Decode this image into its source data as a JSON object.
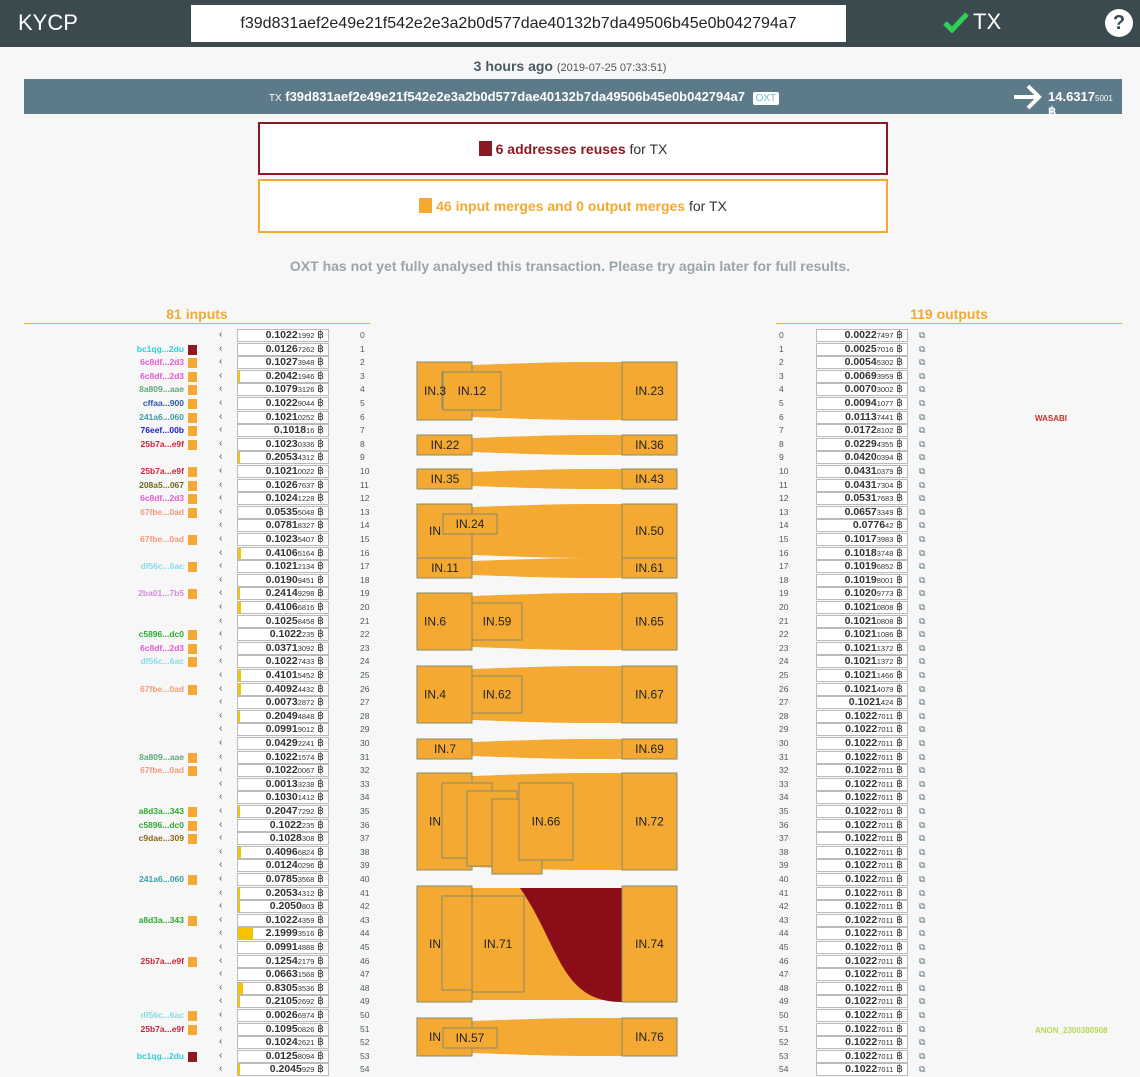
{
  "app": {
    "brand": "KYCP",
    "search_value": "f39d831aef2e49e21f542e2e3a2b0d577dae40132b7da49506b45e0b042794a7",
    "tx_label": "TX",
    "help": "?"
  },
  "time": {
    "relative": "3 hours ago",
    "absolute": "(2019-07-25 07:33:51)"
  },
  "txbar": {
    "prefix": "TX",
    "txid": "f39d831aef2e49e21f542e2e3a2b0d577dae40132b7da49506b45e0b042794a7",
    "oxt": "OXT",
    "amount_main": "14.6317",
    "amount_small": "5001",
    "btc": "฿"
  },
  "boxes": {
    "reuse_count": "6 addresses reuses",
    "reuse_suffix": " for TX",
    "merge_count": "46 input merges and 0 output merges",
    "merge_suffix": " for TX"
  },
  "note": "OXT has not yet fully analysed this transaction. Please try again later for full results.",
  "inputs_header": "81 inputs",
  "outputs_header": "119 outputs",
  "colors": {
    "reuse": "#8b1a25",
    "merge": "#f3a932",
    "bar": "#5d7a88",
    "yellow": "#f6c300"
  },
  "inputs": [
    {
      "label": "",
      "color": "",
      "v1": "0.1022",
      "v2": "1992",
      "fill": 0
    },
    {
      "label": "bc1qg...2du",
      "color": "#2dcfd8",
      "sq": "#8b1a25",
      "v1": "0.0126",
      "v2": "7262",
      "fill": 0
    },
    {
      "label": "6c8df...2d3",
      "color": "#e45ad6",
      "sq": "#f3a932",
      "v1": "0.1027",
      "v2": "3948",
      "fill": 0
    },
    {
      "label": "6c8df...2d3",
      "color": "#e45ad6",
      "sq": "#f3a932",
      "v1": "0.2042",
      "v2": "1946",
      "fill": 2
    },
    {
      "label": "8a809...aae",
      "color": "#5fa87a",
      "sq": "#f3a932",
      "v1": "0.1079",
      "v2": "3126",
      "fill": 0
    },
    {
      "label": "cffaa...900",
      "color": "#2b5aa8",
      "sq": "#f3a932",
      "v1": "0.1022",
      "v2": "9044",
      "fill": 0
    },
    {
      "label": "241a6...060",
      "color": "#3a9ea8",
      "sq": "#f3a932",
      "v1": "0.1021",
      "v2": "0252",
      "fill": 0
    },
    {
      "label": "76eef...00b",
      "color": "#1c22c8",
      "sq": "#f3a932",
      "v1": "0.1018",
      "v2": "16",
      "fill": 0
    },
    {
      "label": "25b7a...e9f",
      "color": "#c8243a",
      "sq": "#f3a932",
      "v1": "0.1023",
      "v2": "0336",
      "fill": 0
    },
    {
      "label": "",
      "color": "",
      "v1": "0.2053",
      "v2": "4312",
      "fill": 2
    },
    {
      "label": "25b7a...e9f",
      "color": "#c8243a",
      "sq": "#f3a932",
      "v1": "0.1021",
      "v2": "0022",
      "fill": 0
    },
    {
      "label": "208a5...067",
      "color": "#6c6c18",
      "sq": "#f3a932",
      "v1": "0.1026",
      "v2": "7637",
      "fill": 0
    },
    {
      "label": "6c8df...2d3",
      "color": "#e45ad6",
      "sq": "#f3a932",
      "v1": "0.1024",
      "v2": "1228",
      "fill": 0
    },
    {
      "label": "67fbe...0ad",
      "color": "#f29a7a",
      "sq": "#f3a932",
      "v1": "0.0535",
      "v2": "5048",
      "fill": 0
    },
    {
      "label": "",
      "color": "",
      "v1": "0.0781",
      "v2": "8327",
      "fill": 0
    },
    {
      "label": "67fbe...0ad",
      "color": "#f29a7a",
      "sq": "#f3a932",
      "v1": "0.1023",
      "v2": "5407",
      "fill": 0
    },
    {
      "label": "",
      "color": "",
      "v1": "0.4106",
      "v2": "5164",
      "fill": 3
    },
    {
      "label": "df56c...6ac",
      "color": "#8adbe8",
      "sq": "#f3a932",
      "v1": "0.1021",
      "v2": "2134",
      "fill": 0
    },
    {
      "label": "",
      "color": "",
      "v1": "0.0190",
      "v2": "9451",
      "fill": 0
    },
    {
      "label": "2ba01...7b5",
      "color": "#d58ae0",
      "sq": "#f3a932",
      "v1": "0.2414",
      "v2": "9298",
      "fill": 2
    },
    {
      "label": "",
      "color": "",
      "v1": "0.4106",
      "v2": "6816",
      "fill": 3
    },
    {
      "label": "",
      "color": "",
      "v1": "0.1025",
      "v2": "8458",
      "fill": 0
    },
    {
      "label": "c5896...dc0",
      "color": "#2fa833",
      "sq": "#f3a932",
      "v1": "0.1022",
      "v2": "235",
      "fill": 0
    },
    {
      "label": "6c8df...2d3",
      "color": "#e45ad6",
      "sq": "#f3a932",
      "v1": "0.0371",
      "v2": "3092",
      "fill": 0
    },
    {
      "label": "df56c...6ac",
      "color": "#8adbe8",
      "sq": "#f3a932",
      "v1": "0.1022",
      "v2": "7433",
      "fill": 0
    },
    {
      "label": "",
      "color": "",
      "v1": "0.4101",
      "v2": "5452",
      "fill": 3
    },
    {
      "label": "67fbe...0ad",
      "color": "#f29a7a",
      "sq": "#f3a932",
      "v1": "0.4092",
      "v2": "4432",
      "fill": 3
    },
    {
      "label": "",
      "color": "",
      "v1": "0.0073",
      "v2": "2872",
      "fill": 0
    },
    {
      "label": "",
      "color": "",
      "v1": "0.2049",
      "v2": "4848",
      "fill": 2
    },
    {
      "label": "",
      "color": "",
      "v1": "0.0991",
      "v2": "9012",
      "fill": 0
    },
    {
      "label": "",
      "color": "",
      "v1": "0.0429",
      "v2": "2241",
      "fill": 0
    },
    {
      "label": "8a809...aae",
      "color": "#5fa87a",
      "sq": "#f3a932",
      "v1": "0.1022",
      "v2": "1574",
      "fill": 0
    },
    {
      "label": "67fbe...0ad",
      "color": "#f29a7a",
      "sq": "#f3a932",
      "v1": "0.1022",
      "v2": "0067",
      "fill": 0
    },
    {
      "label": "",
      "color": "",
      "v1": "0.0013",
      "v2": "3238",
      "fill": 0
    },
    {
      "label": "",
      "color": "",
      "v1": "0.1030",
      "v2": "1412",
      "fill": 0
    },
    {
      "label": "a8d3a...343",
      "color": "#2fa833",
      "sq": "#f3a932",
      "v1": "0.2047",
      "v2": "7292",
      "fill": 2
    },
    {
      "label": "c5896...dc0",
      "color": "#2fa833",
      "sq": "#f3a932",
      "v1": "0.1022",
      "v2": "235",
      "fill": 0
    },
    {
      "label": "c9dae...309",
      "color": "#8a6a18",
      "sq": "#f3a932",
      "v1": "0.1028",
      "v2": "308",
      "fill": 0
    },
    {
      "label": "",
      "color": "",
      "v1": "0.4096",
      "v2": "6824",
      "fill": 3
    },
    {
      "label": "",
      "color": "",
      "v1": "0.0124",
      "v2": "0296",
      "fill": 0
    },
    {
      "label": "241a6...060",
      "color": "#3a9ea8",
      "sq": "#f3a932",
      "v1": "0.0785",
      "v2": "3568",
      "fill": 0
    },
    {
      "label": "",
      "color": "",
      "v1": "0.2053",
      "v2": "4312",
      "fill": 2
    },
    {
      "label": "",
      "color": "",
      "v1": "0.2050",
      "v2": "803",
      "fill": 2
    },
    {
      "label": "a8d3a...343",
      "color": "#2fa833",
      "sq": "#f3a932",
      "v1": "0.1022",
      "v2": "4359",
      "fill": 0
    },
    {
      "label": "",
      "color": "",
      "v1": "2.1999",
      "v2": "3516",
      "fill": 15
    },
    {
      "label": "",
      "color": "",
      "v1": "0.0991",
      "v2": "4888",
      "fill": 0
    },
    {
      "label": "25b7a...e9f",
      "color": "#c8243a",
      "sq": "#f3a932",
      "v1": "0.1254",
      "v2": "2179",
      "fill": 0
    },
    {
      "label": "",
      "color": "",
      "v1": "0.0663",
      "v2": "1568",
      "fill": 0
    },
    {
      "label": "",
      "color": "",
      "v1": "0.8305",
      "v2": "3536",
      "fill": 5
    },
    {
      "label": "",
      "color": "",
      "v1": "0.2105",
      "v2": "2692",
      "fill": 2
    },
    {
      "label": "df56c...6ac",
      "color": "#8adbe8",
      "sq": "#f3a932",
      "v1": "0.0026",
      "v2": "6974",
      "fill": 0
    },
    {
      "label": "25b7a...e9f",
      "color": "#c8243a",
      "sq": "#f3a932",
      "v1": "0.1095",
      "v2": "0826",
      "fill": 0
    },
    {
      "label": "",
      "color": "",
      "v1": "0.1024",
      "v2": "2621",
      "fill": 0
    },
    {
      "label": "bc1qg...2du",
      "color": "#2dcfd8",
      "sq": "#8b1a25",
      "v1": "0.0125",
      "v2": "8094",
      "fill": 0
    },
    {
      "label": "",
      "color": "",
      "v1": "0.2045",
      "v2": "929",
      "fill": 2
    }
  ],
  "outputs": [
    {
      "v1": "0.0022",
      "v2": "7497"
    },
    {
      "v1": "0.0025",
      "v2": "7016"
    },
    {
      "v1": "0.0054",
      "v2": "5302"
    },
    {
      "v1": "0.0069",
      "v2": "3959"
    },
    {
      "v1": "0.0070",
      "v2": "3002"
    },
    {
      "v1": "0.0094",
      "v2": "1077"
    },
    {
      "v1": "0.0113",
      "v2": "7441"
    },
    {
      "v1": "0.0172",
      "v2": "8102"
    },
    {
      "v1": "0.0229",
      "v2": "4355"
    },
    {
      "v1": "0.0420",
      "v2": "0394"
    },
    {
      "v1": "0.0431",
      "v2": "0379"
    },
    {
      "v1": "0.0431",
      "v2": "7304"
    },
    {
      "v1": "0.0531",
      "v2": "7683"
    },
    {
      "v1": "0.0657",
      "v2": "3349"
    },
    {
      "v1": "0.0776",
      "v2": "42"
    },
    {
      "v1": "0.1017",
      "v2": "3983"
    },
    {
      "v1": "0.1018",
      "v2": "3748"
    },
    {
      "v1": "0.1019",
      "v2": "6852"
    },
    {
      "v1": "0.1019",
      "v2": "8001"
    },
    {
      "v1": "0.1020",
      "v2": "9773"
    },
    {
      "v1": "0.1021",
      "v2": "0808"
    },
    {
      "v1": "0.1021",
      "v2": "0808"
    },
    {
      "v1": "0.1021",
      "v2": "1086"
    },
    {
      "v1": "0.1021",
      "v2": "1372"
    },
    {
      "v1": "0.1021",
      "v2": "1372"
    },
    {
      "v1": "0.1021",
      "v2": "1466"
    },
    {
      "v1": "0.1021",
      "v2": "4079"
    },
    {
      "v1": "0.1021",
      "v2": "424"
    },
    {
      "v1": "0.1022",
      "v2": "7011"
    },
    {
      "v1": "0.1022",
      "v2": "7011"
    },
    {
      "v1": "0.1022",
      "v2": "7011"
    },
    {
      "v1": "0.1022",
      "v2": "7011"
    },
    {
      "v1": "0.1022",
      "v2": "7011"
    },
    {
      "v1": "0.1022",
      "v2": "7011"
    },
    {
      "v1": "0.1022",
      "v2": "7011"
    },
    {
      "v1": "0.1022",
      "v2": "7011"
    },
    {
      "v1": "0.1022",
      "v2": "7011"
    },
    {
      "v1": "0.1022",
      "v2": "7011"
    },
    {
      "v1": "0.1022",
      "v2": "7011"
    },
    {
      "v1": "0.1022",
      "v2": "7011"
    },
    {
      "v1": "0.1022",
      "v2": "7011"
    },
    {
      "v1": "0.1022",
      "v2": "7011"
    },
    {
      "v1": "0.1022",
      "v2": "7011"
    },
    {
      "v1": "0.1022",
      "v2": "7011"
    },
    {
      "v1": "0.1022",
      "v2": "7011"
    },
    {
      "v1": "0.1022",
      "v2": "7011"
    },
    {
      "v1": "0.1022",
      "v2": "7011"
    },
    {
      "v1": "0.1022",
      "v2": "7011"
    },
    {
      "v1": "0.1022",
      "v2": "7011"
    },
    {
      "v1": "0.1022",
      "v2": "7011"
    },
    {
      "v1": "0.1022",
      "v2": "7011"
    },
    {
      "v1": "0.1022",
      "v2": "7011"
    },
    {
      "v1": "0.1022",
      "v2": "7011"
    },
    {
      "v1": "0.1022",
      "v2": "7011"
    },
    {
      "v1": "0.1022",
      "v2": "7011"
    }
  ],
  "output_tags": [
    {
      "text": "WASABI",
      "color": "#d0302a",
      "row": 6
    },
    {
      "text": "ANON_2300380908",
      "color": "#b8d85a",
      "row": 51
    }
  ],
  "flows": [
    {
      "a": "IN.3",
      "b": "IN.12",
      "c": "IN.23"
    },
    {
      "a": "IN.22",
      "c": "IN.36"
    },
    {
      "a": "IN.35",
      "c": "IN.43"
    },
    {
      "a": "IN",
      "b": "IN.24",
      "c": "IN.50"
    },
    {
      "a": "IN.11",
      "c": "IN.61"
    },
    {
      "a": "IN.6",
      "b": "IN.59",
      "c": "IN.65"
    },
    {
      "a": "IN.4",
      "b": "IN.62",
      "c": "IN.67"
    },
    {
      "a": "IN.7",
      "c": "IN.69"
    },
    {
      "a": "IN",
      "b": "IN.66",
      "c": "IN.72"
    },
    {
      "a": "IN",
      "b": "IN.71",
      "c": "IN.74"
    },
    {
      "a": "IN",
      "b": "IN.57",
      "c": "IN.76"
    }
  ]
}
